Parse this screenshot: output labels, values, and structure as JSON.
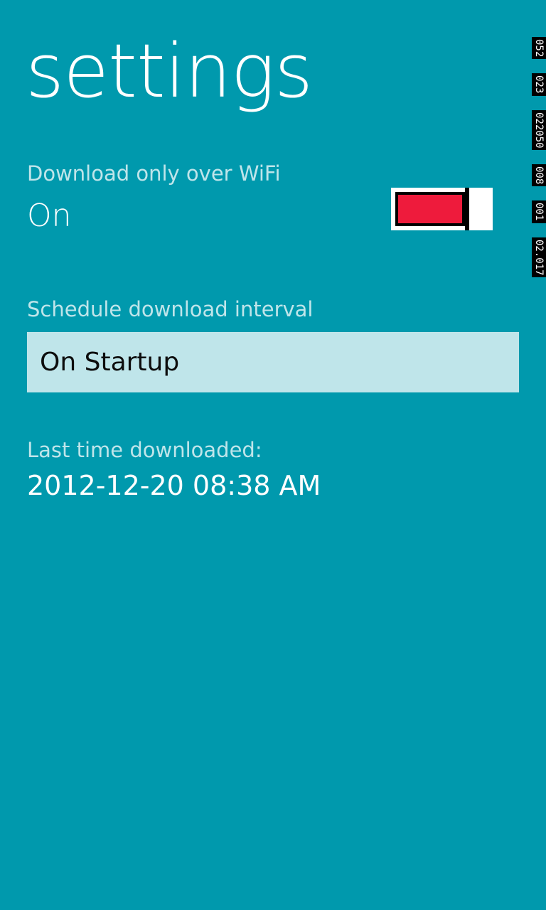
{
  "page": {
    "title": "settings"
  },
  "wifi": {
    "label": "Download only over WiFi",
    "value": "On",
    "toggle_on": true,
    "toggle_fill_color": "#ee1b3c"
  },
  "interval": {
    "label": "Schedule download interval",
    "selected": "On Startup"
  },
  "last_download": {
    "label": "Last time downloaded:",
    "value": "2012-12-20 08:38 AM"
  },
  "debug_counters": [
    "052",
    "023",
    "022050",
    "008",
    "001",
    "02.017"
  ],
  "colors": {
    "background": "#0099ad",
    "label": "#bfe5ea",
    "picker_bg": "#bfe5ea",
    "text": "#ffffff"
  }
}
